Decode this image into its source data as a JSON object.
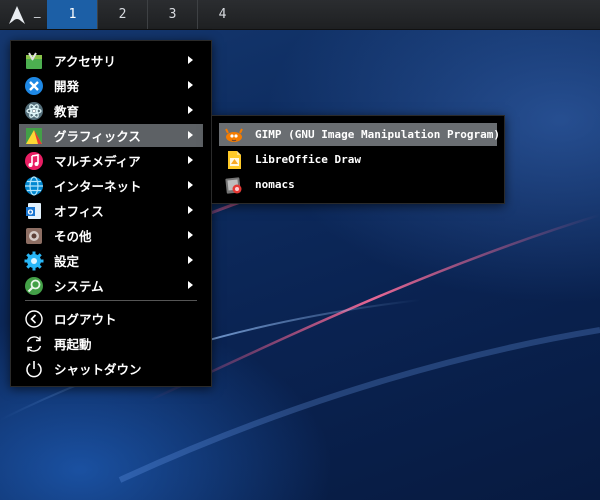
{
  "topbar": {
    "launcher_icon": "arch-logo-icon",
    "minimize_label": "_",
    "workspaces": [
      "1",
      "2",
      "3",
      "4"
    ],
    "active_workspace": "1",
    "active_color": "#1c5fa6"
  },
  "main_menu": {
    "items": [
      {
        "label": "アクセサリ",
        "icon": "accessories-icon",
        "submenu": true
      },
      {
        "label": "開発",
        "icon": "development-icon",
        "submenu": true
      },
      {
        "label": "教育",
        "icon": "education-icon",
        "submenu": true
      },
      {
        "label": "グラフィックス",
        "icon": "graphics-icon",
        "submenu": true,
        "highlighted": true
      },
      {
        "label": "マルチメディア",
        "icon": "multimedia-icon",
        "submenu": true
      },
      {
        "label": "インターネット",
        "icon": "internet-icon",
        "submenu": true
      },
      {
        "label": "オフィス",
        "icon": "office-icon",
        "submenu": true
      },
      {
        "label": "その他",
        "icon": "other-icon",
        "submenu": true
      },
      {
        "label": "設定",
        "icon": "settings-icon",
        "submenu": true
      },
      {
        "label": "システム",
        "icon": "system-icon",
        "submenu": true
      }
    ],
    "session": [
      {
        "label": "ログアウト",
        "icon": "logout-icon"
      },
      {
        "label": "再起動",
        "icon": "restart-icon"
      },
      {
        "label": "シャットダウン",
        "icon": "shutdown-icon"
      }
    ]
  },
  "graphics_submenu": {
    "items": [
      {
        "label": "GIMP (GNU Image Manipulation Program)",
        "icon": "gimp-icon",
        "highlighted": true
      },
      {
        "label": "LibreOffice Draw",
        "icon": "libreoffice-draw-icon"
      },
      {
        "label": "nomacs",
        "icon": "nomacs-icon"
      }
    ]
  },
  "colors": {
    "menu_background": "#000000",
    "menu_highlight": "#5d6165",
    "topbar": "#2b2d30"
  }
}
